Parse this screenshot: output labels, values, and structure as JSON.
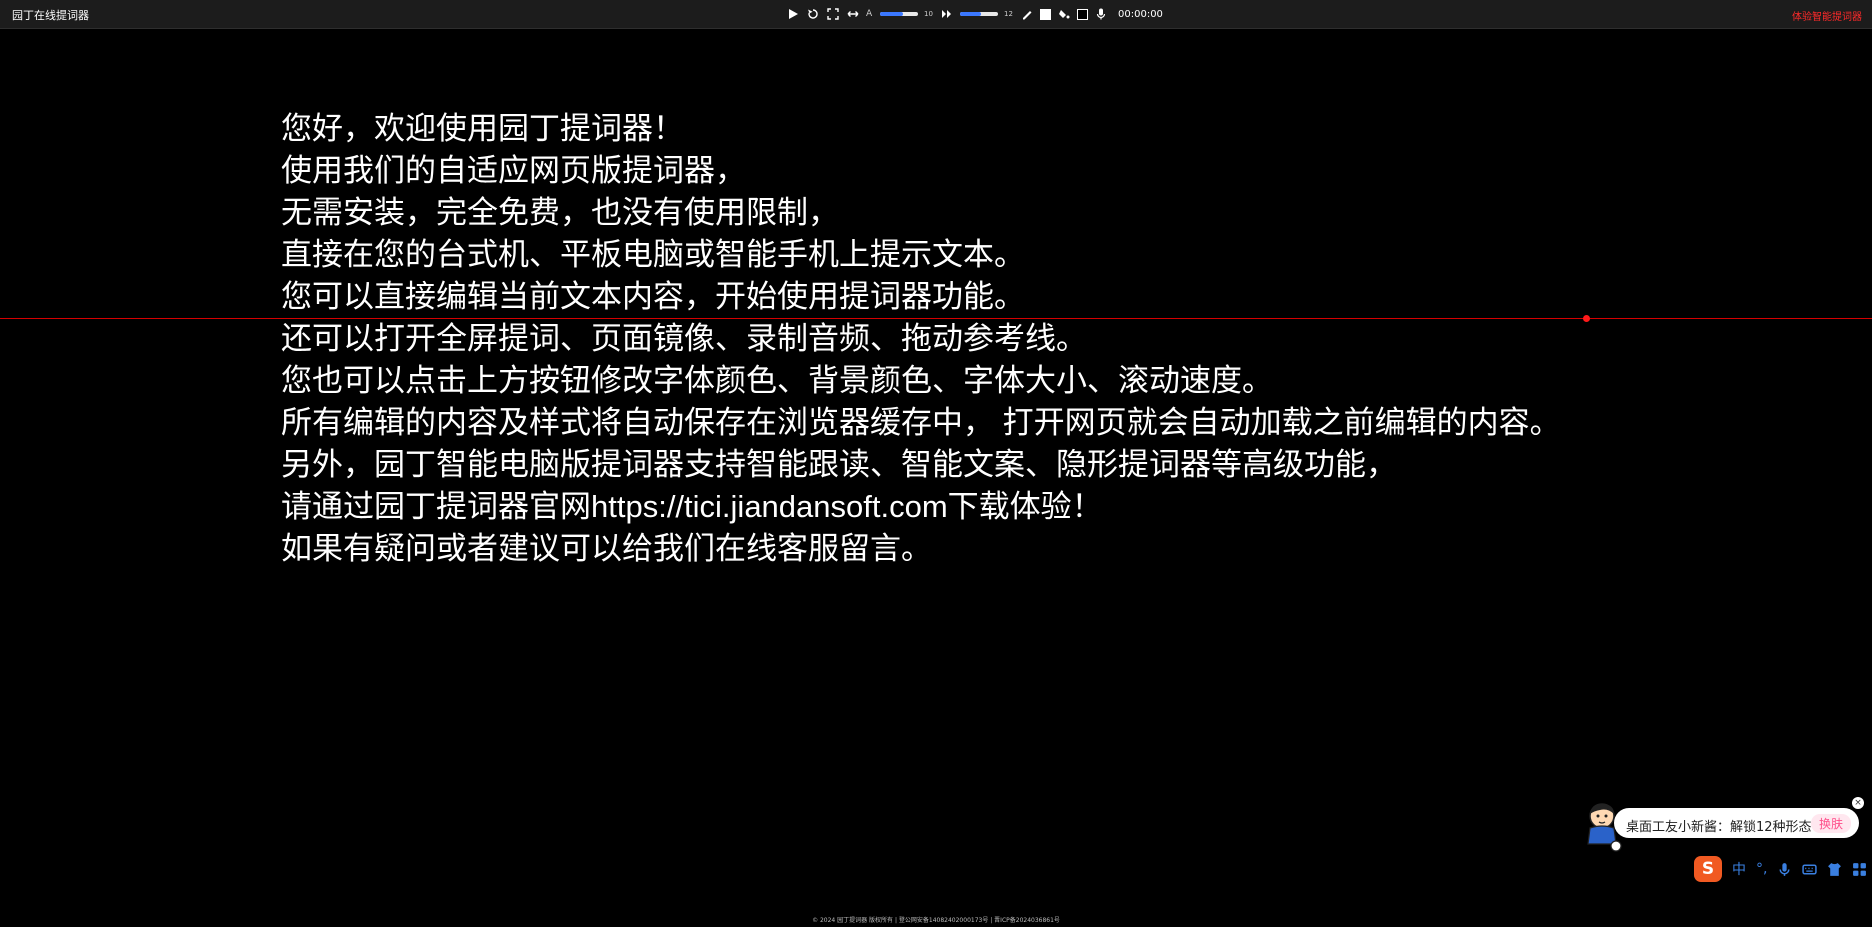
{
  "app": {
    "title": "园丁在线提词器"
  },
  "toolbar": {
    "font_icon_label": "A",
    "font_size_value": "10",
    "speed_value": "12",
    "timer": "00:00:00",
    "font_size_level": 0.6,
    "speed_level": 0.55,
    "icons": [
      "play-icon",
      "reset-icon",
      "fullscreen-icon",
      "mirror-icon",
      "font-size-icon",
      "speed-icon",
      "text-color-icon",
      "background-color-icon",
      "microphone-icon"
    ]
  },
  "top_link": "体验智能提词器",
  "script": {
    "lines": [
      "您好，欢迎使用园丁提词器！",
      "使用我们的自适应网页版提词器，",
      "无需安装，完全免费，也没有使用限制，",
      "直接在您的台式机、平板电脑或智能手机上提示文本。",
      "您可以直接编辑当前文本内容，开始使用提词器功能。",
      "还可以打开全屏提词、页面镜像、录制音频、拖动参考线。",
      "您也可以点击上方按钮修改字体颜色、背景颜色、字体大小、滚动速度。",
      "所有编辑的内容及样式将自动保存在浏览器缓存中， 打开网页就会自动加载之前编辑的内容。",
      "另外，园丁智能电脑版提词器支持智能跟读、智能文案、隐形提词器等高级功能，",
      "请通过园丁提词器官网https://tici.jiandansoft.com下载体验！",
      "如果有疑问或者建议可以给我们在线客服留言。"
    ]
  },
  "footer": "© 2024 园丁提词器 版权所有 | 登公网安备14082402000173号 | 晋ICP备2024036861号",
  "ime": {
    "bubble_text": "桌面工友小新酱：解锁12种形态",
    "bubble_button": "换肤",
    "close": "×",
    "logo": "S",
    "mode": "中",
    "punct": "°,"
  },
  "colors": {
    "accent_red": "#ff2a2a",
    "guide_red": "#d40000",
    "slider_blue": "#3b78ff",
    "ime_orange": "#f15a22",
    "ime_blue": "#3a7fe0"
  }
}
